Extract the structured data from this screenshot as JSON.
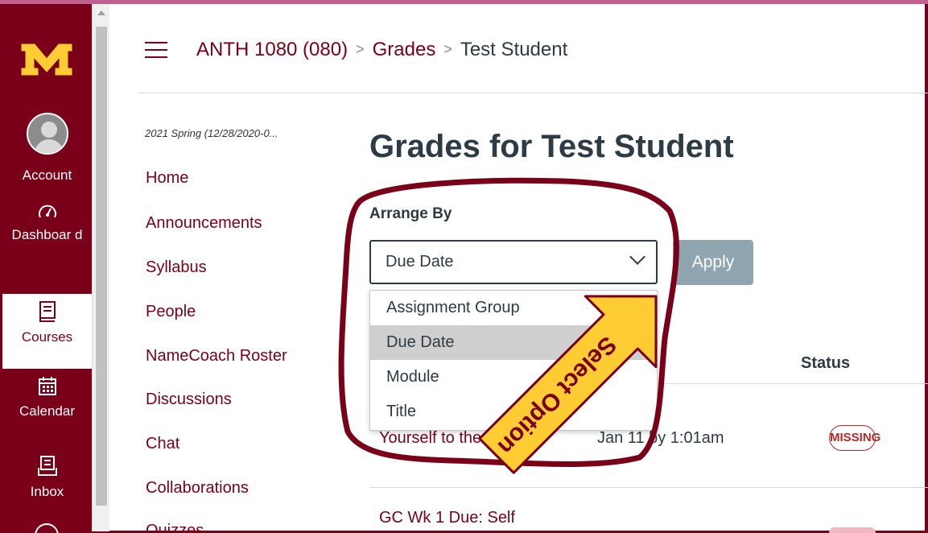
{
  "global_nav": {
    "logo_icon": "university-m-logo-icon",
    "items": [
      {
        "label": "Account",
        "icon": "user-avatar-icon"
      },
      {
        "label": "Dashboar d",
        "icon": "dashboard-gauge-icon"
      },
      {
        "label": "Courses",
        "icon": "book-icon"
      },
      {
        "label": "Calendar",
        "icon": "calendar-icon"
      },
      {
        "label": "Inbox",
        "icon": "inbox-icon"
      }
    ]
  },
  "breadcrumb": {
    "course": "ANTH 1080 (080)",
    "section": "Grades",
    "current": "Test Student",
    "separator": ">"
  },
  "course_nav": {
    "term": "2021 Spring (12/28/2020-0...",
    "items": [
      "Home",
      "Announcements",
      "Syllabus",
      "People",
      "NameCoach Roster",
      "Discussions",
      "Chat",
      "Collaborations",
      "Quizzes"
    ]
  },
  "main": {
    "title": "Grades for Test Student",
    "arrange_label": "Arrange By",
    "select_value": "Due Date",
    "apply_label": "Apply",
    "options": [
      "Assignment Group",
      "Due Date",
      "Module",
      "Title"
    ],
    "selected_option": "Due Date",
    "status_header": "Status",
    "rows": [
      {
        "name": "Yourself to the Class",
        "date": "Jan 11 by 1:01am",
        "status": "MISSING"
      },
      {
        "name": "GC Wk 1 Due: Self"
      }
    ]
  },
  "annotation": {
    "callout_text": "Select Option",
    "colors": {
      "outline": "#7a0019",
      "arrow_fill": "#ffcc33",
      "text": "#7a0019"
    }
  },
  "colors": {
    "brand": "#7a0019",
    "link": "#7a0019",
    "apply_disabled": "#8fa5b0"
  }
}
